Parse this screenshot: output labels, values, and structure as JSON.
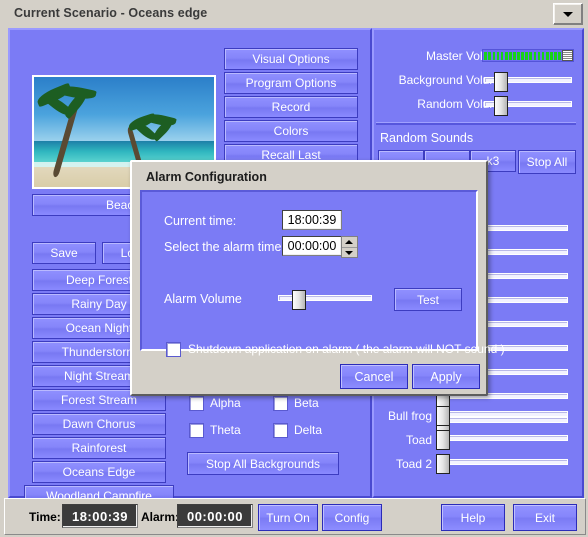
{
  "window": {
    "title": "Current Scenario - Oceans edge",
    "dropdown_icon": "chevron-down-icon"
  },
  "scenario": {
    "image_caption": "Beach"
  },
  "left_panel": {
    "save_label": "Save",
    "load_label": "Load",
    "presets": [
      "Deep Forest",
      "Rainy Day",
      "Ocean Night",
      "Thunderstorm",
      "Night Stream",
      "Forest Stream",
      "Dawn Chorus",
      "Rainforest",
      "Oceans Edge",
      "Woodland Campfire"
    ]
  },
  "middle_panel": {
    "buttons": [
      "Visual Options",
      "Program Options",
      "Record",
      "Colors",
      "Recall Last"
    ],
    "brainwave_checkboxes": [
      "Alpha",
      "Beta",
      "Theta",
      "Delta"
    ],
    "stop_all_backgrounds": "Stop All Backgrounds"
  },
  "right_panel": {
    "master_volume_label": "Master Volume",
    "background_volume_label": "Background Volume",
    "random_volume_label": "Random Volume",
    "master_volume_segments": 22,
    "background_volume_percent": 12,
    "random_volume_percent": 12,
    "random_sounds_label": "Random Sounds",
    "random_track_button": "k3",
    "stop_all_label": "Stop All",
    "sound_sliders": [
      {
        "label": "",
        "value": 4
      },
      {
        "label": "",
        "value": 4
      },
      {
        "label": "",
        "value": 4
      },
      {
        "label": "",
        "value": 4
      },
      {
        "label": "",
        "value": 4
      },
      {
        "label": "",
        "value": 4
      },
      {
        "label": "",
        "value": 4
      },
      {
        "label": "",
        "value": 4
      },
      {
        "label": "",
        "value": 4
      },
      {
        "label": "Bull frog",
        "value": 4
      },
      {
        "label": "Toad",
        "value": 4
      },
      {
        "label": "Toad 2",
        "value": 4
      }
    ]
  },
  "dialog": {
    "title": "Alarm Configuration",
    "current_time_label": "Current time:",
    "current_time_value": "18:00:39",
    "alarm_time_label": "Select the alarm time",
    "alarm_time_value": "00:00:00",
    "alarm_volume_label": "Alarm Volume",
    "alarm_volume_percent": 16,
    "test_button": "Test",
    "shutdown_checkbox_label": "Shutdown application on alarm ( the alarm will NOT sound )",
    "cancel_button": "Cancel",
    "apply_button": "Apply"
  },
  "status_bar": {
    "time_label": "Time:",
    "time_value": "18:00:39",
    "alarm_label": "Alarm:",
    "alarm_value": "00:00:00",
    "turn_on_button": "Turn On",
    "config_button": "Config",
    "help_button": "Help",
    "exit_button": "Exit"
  },
  "colors": {
    "panel_blue": "#7b7bf5",
    "chrome_gray": "#d4d0c8",
    "meter_green": "#17d317",
    "text_white": "#ffffff"
  }
}
